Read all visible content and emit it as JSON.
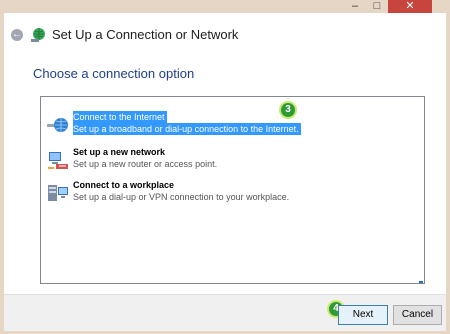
{
  "window": {
    "title": "Set Up a Connection or Network",
    "controls": {
      "minimize": "–",
      "maximize": "□",
      "close": "✕"
    }
  },
  "page": {
    "heading": "Choose a connection option"
  },
  "options": [
    {
      "title": "Connect to the Internet",
      "description": "Set up a broadband or dial-up connection to the Internet.",
      "icon": "globe-connection-icon",
      "selected": true
    },
    {
      "title": "Set up a new network",
      "description": "Set up a new router or access point.",
      "icon": "router-network-icon",
      "selected": false
    },
    {
      "title": "Connect to a workplace",
      "description": "Set up a dial-up or VPN connection to your workplace.",
      "icon": "workplace-computer-icon",
      "selected": false
    }
  ],
  "badges": {
    "step3": "3",
    "step4": "4"
  },
  "buttons": {
    "next": "Next",
    "cancel": "Cancel"
  },
  "colors": {
    "selection": "#3399ff",
    "heading": "#1e3f8a",
    "badge": "#2f9a36",
    "badge_glow": "#c9ea6e",
    "titlebar": "#e6d6c6",
    "close": "#c7453c"
  }
}
